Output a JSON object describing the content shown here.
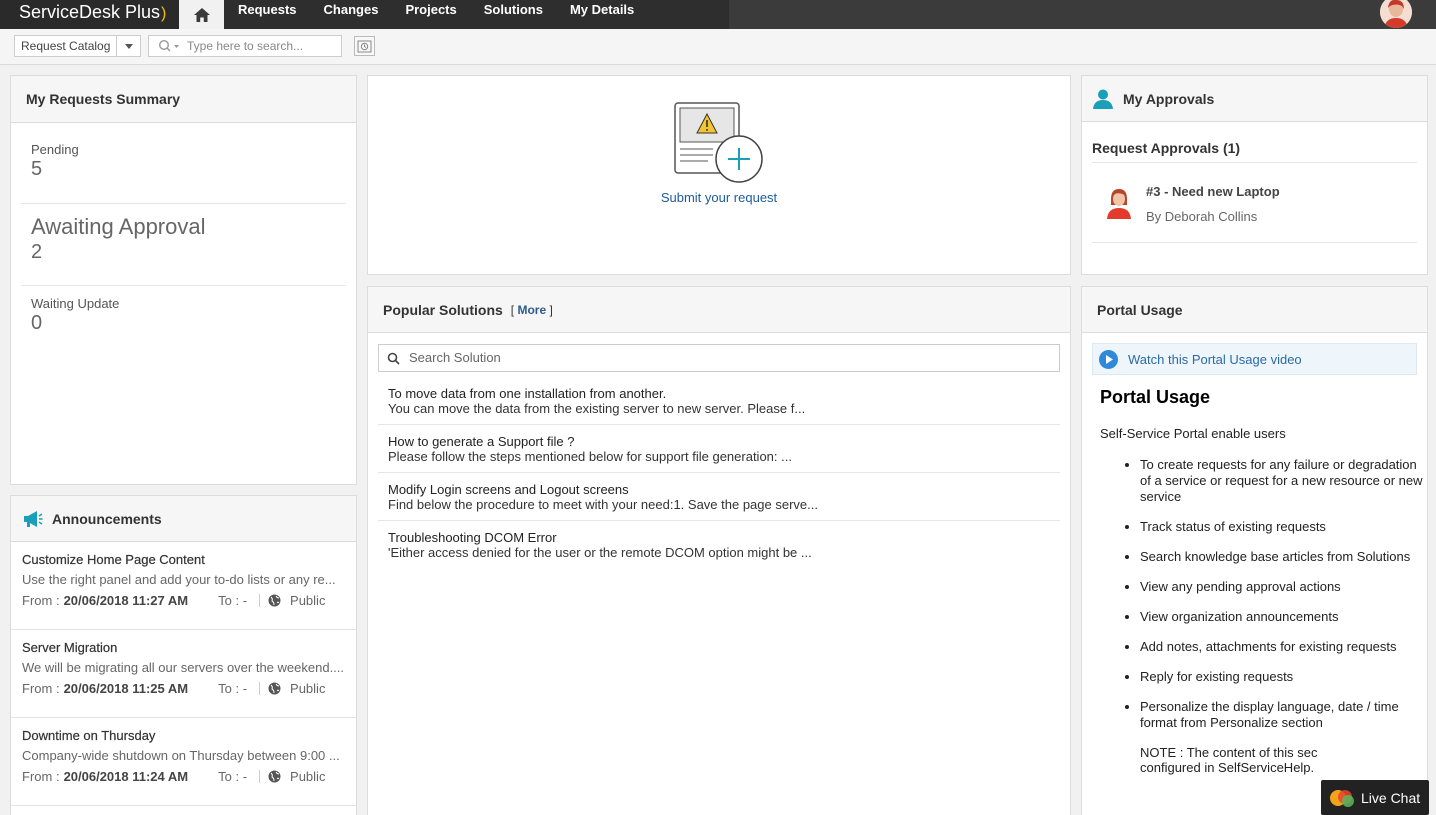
{
  "header": {
    "app_name": "ServiceDesk Plus",
    "nav": [
      "Requests",
      "Changes",
      "Projects",
      "Solutions",
      "My Details"
    ]
  },
  "toolbar": {
    "catalog_label": "Request Catalog",
    "search_placeholder": "Type here to search..."
  },
  "summary": {
    "title": "My Requests Summary",
    "items": [
      {
        "label": "Pending",
        "value": "5"
      },
      {
        "label": "Awaiting Approval",
        "value": "2"
      },
      {
        "label": "Waiting Update",
        "value": "0"
      }
    ]
  },
  "submit": {
    "label": "Submit your request"
  },
  "solutions": {
    "title": "Popular Solutions",
    "more_open": "[ ",
    "more_label": "More",
    "more_close": " ]",
    "search_placeholder": "Search Solution",
    "items": [
      {
        "title": "To move data from one installation from another.",
        "desc": "You can move the data from the existing server to new server. Please f..."
      },
      {
        "title": "How to generate a Support file ?",
        "desc": "Please follow the steps mentioned below for support file generation: ..."
      },
      {
        "title": "Modify Login screens and Logout screens",
        "desc": "Find below the procedure to meet with your need:1. Save the page serve..."
      },
      {
        "title": "Troubleshooting DCOM Error",
        "desc": "'Either access denied for the user or the remote DCOM option might be ..."
      }
    ]
  },
  "approvals": {
    "title": "My Approvals",
    "subtitle": "Request Approvals (1)",
    "items": [
      {
        "title": "#3 - Need new Laptop",
        "by": "By Deborah Collins"
      }
    ]
  },
  "announcements": {
    "title": "Announcements",
    "from_label": "From :",
    "to_label": "To : -",
    "visibility": "Public",
    "items": [
      {
        "title": "Customize Home Page Content",
        "desc": "Use the right panel and add your to-do lists or any re...",
        "date": "20/06/2018 11:27 AM"
      },
      {
        "title": "Server Migration",
        "desc": "We will be migrating all our servers over the weekend....",
        "date": "20/06/2018 11:25 AM"
      },
      {
        "title": "Downtime on Thursday",
        "desc": "Company-wide shutdown on Thursday between 9:00 ...",
        "date": "20/06/2018 11:24 AM"
      }
    ]
  },
  "portal_usage": {
    "title": "Portal Usage",
    "video_link": "Watch this Portal Usage video",
    "heading": "Portal Usage",
    "intro": "Self-Service Portal enable users",
    "bullets": [
      "To create requests for any failure or degradation of a service or request for a new resource or new service",
      "Track status of existing requests",
      "Search knowledge base articles from Solutions",
      "View any pending approval actions",
      "View organization announcements",
      "Add notes, attachments for existing requests",
      "Reply for existing requests",
      "Personalize the display language, date / time format from Personalize section"
    ],
    "note_line1": "NOTE : The content of this sec",
    "note_line2": "configured in SelfServiceHelp."
  },
  "live_chat": {
    "label": "Live Chat"
  },
  "colors": {
    "topbar": "#3b3b3b",
    "link": "#1d5b9c",
    "accent_teal": "#1a9fb8"
  }
}
